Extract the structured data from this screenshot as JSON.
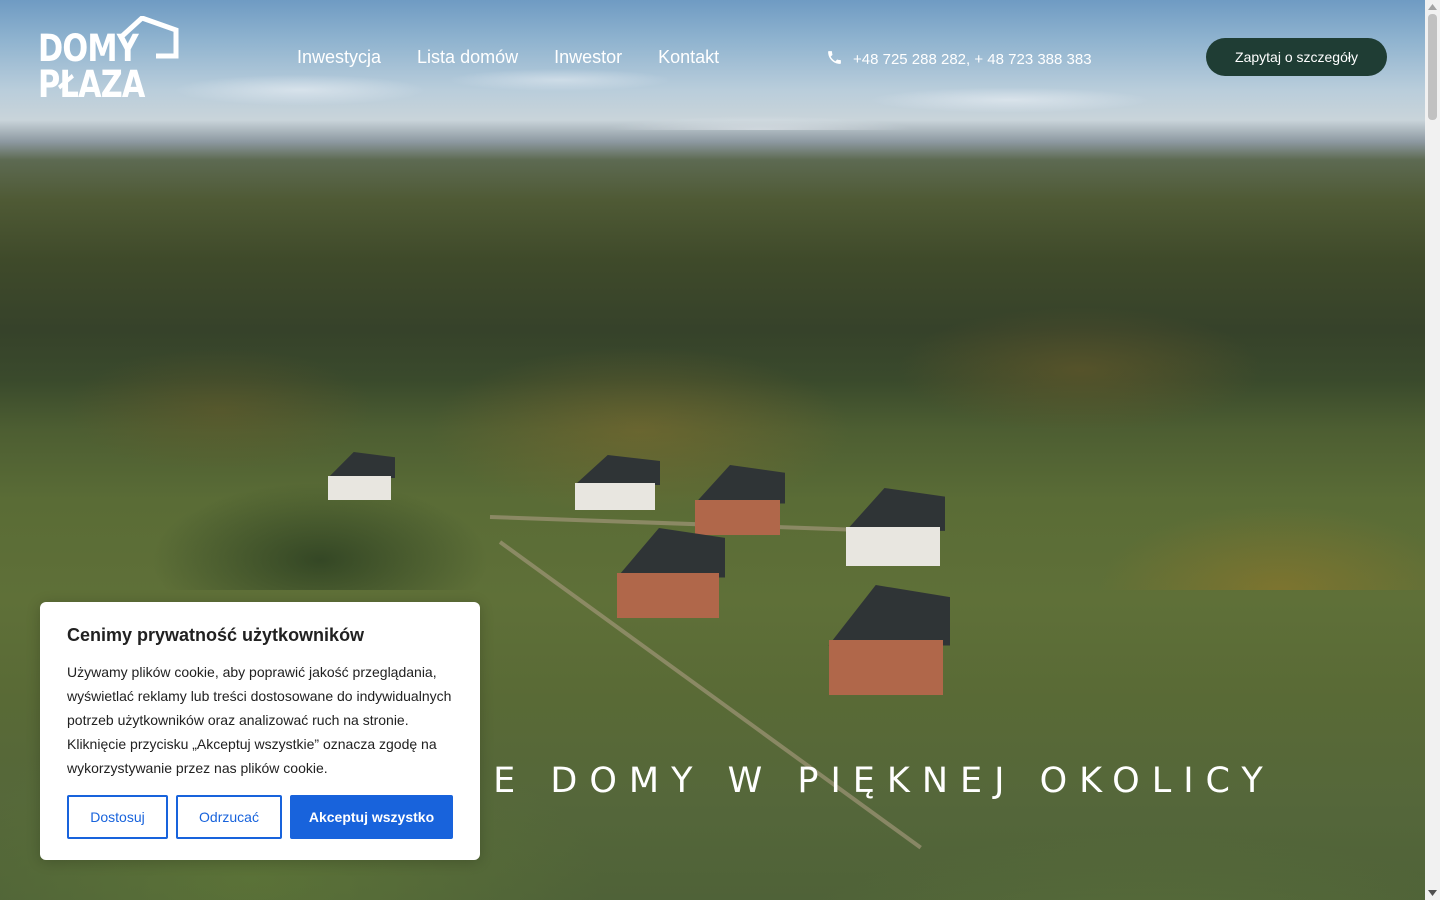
{
  "logo": {
    "line1": "DOMY",
    "line2": "PŁAZA"
  },
  "nav": {
    "items": [
      {
        "label": "Inwestycja"
      },
      {
        "label": "Lista domów"
      },
      {
        "label": "Inwestor"
      },
      {
        "label": "Kontakt"
      }
    ]
  },
  "contact": {
    "phone_icon": "phone-icon",
    "phones": "+48 725 288 282, + 48 723 388 383"
  },
  "cta": {
    "label": "Zapytaj o szczegóły",
    "color": "#1f3d34"
  },
  "hero": {
    "tagline": "NE DOMY W PIĘKNEJ OKOLICY"
  },
  "cookie": {
    "title": "Cenimy prywatność użytkowników",
    "body": "Używamy plików cookie, aby poprawić jakość przeglądania, wyświetlać reklamy lub treści dostosowane do indywidualnych potrzeb użytkowników oraz analizować ruch na stronie. Kliknięcie przycisku „Akceptuj wszystkie” oznacza zgodę na wykorzystywanie przez nas plików cookie.",
    "customize_label": "Dostosuj",
    "reject_label": "Odrzucać",
    "accept_label": "Akceptuj wszystko",
    "accent_color": "#1863dc"
  }
}
